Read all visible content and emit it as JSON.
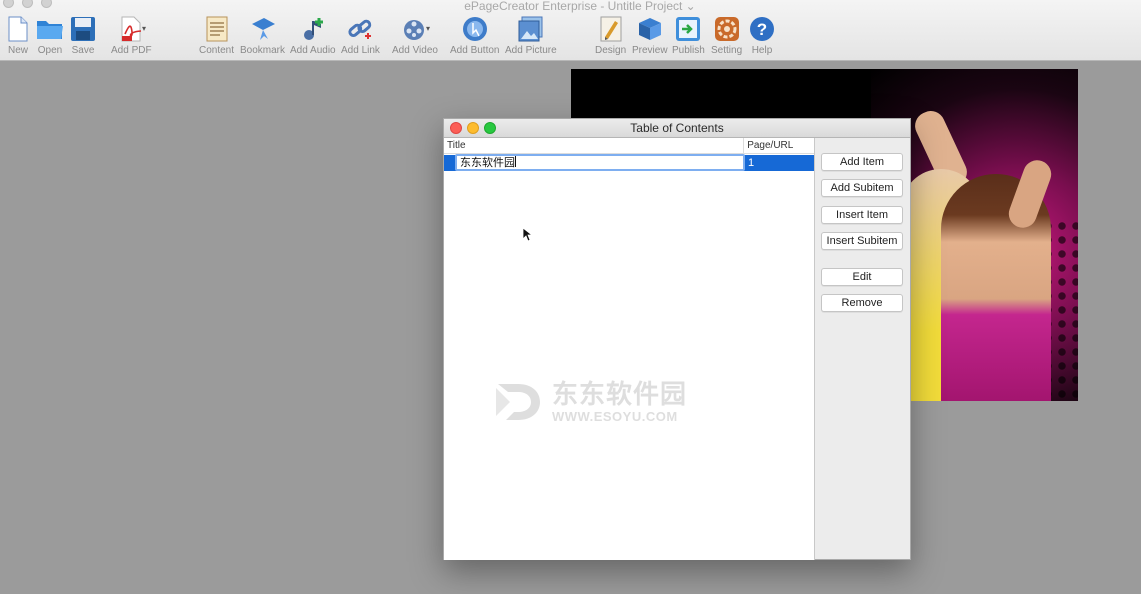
{
  "app": {
    "title": "ePageCreator Enterprise - Untitle Project ⌄"
  },
  "toolbar": {
    "items": [
      {
        "label": "New",
        "icon": "new-doc-icon"
      },
      {
        "label": "Open",
        "icon": "folder-icon"
      },
      {
        "label": "Save",
        "icon": "floppy-icon"
      },
      {
        "label": "Add PDF",
        "icon": "pdf-icon"
      },
      {
        "label": "Content",
        "icon": "content-icon"
      },
      {
        "label": "Bookmark",
        "icon": "bookmark-icon"
      },
      {
        "label": "Add Audio",
        "icon": "audio-icon"
      },
      {
        "label": "Add Link",
        "icon": "link-icon"
      },
      {
        "label": "Add Video",
        "icon": "video-icon"
      },
      {
        "label": "Add Button",
        "icon": "button-icon"
      },
      {
        "label": "Add Picture",
        "icon": "picture-icon"
      },
      {
        "label": "Design",
        "icon": "design-icon"
      },
      {
        "label": "Preview",
        "icon": "preview-icon"
      },
      {
        "label": "Publish",
        "icon": "publish-icon"
      },
      {
        "label": "Setting",
        "icon": "gear-icon"
      },
      {
        "label": "Help",
        "icon": "help-icon"
      }
    ]
  },
  "dialog": {
    "title": "Table of Contents",
    "columns": {
      "title": "Title",
      "page": "Page/URL"
    },
    "rows": [
      {
        "title": "东东软件园",
        "page": "1"
      }
    ],
    "buttons": {
      "add_item": "Add Item",
      "add_subitem": "Add Subitem",
      "insert_item": "Insert Item",
      "insert_subitem": "Insert Subitem",
      "edit": "Edit",
      "remove": "Remove"
    },
    "watermark": {
      "cn": "东东软件园",
      "en": "WWW.ESOYU.COM"
    }
  },
  "colors": {
    "selection": "#1669d6",
    "canvas": "#9b9b9b"
  }
}
